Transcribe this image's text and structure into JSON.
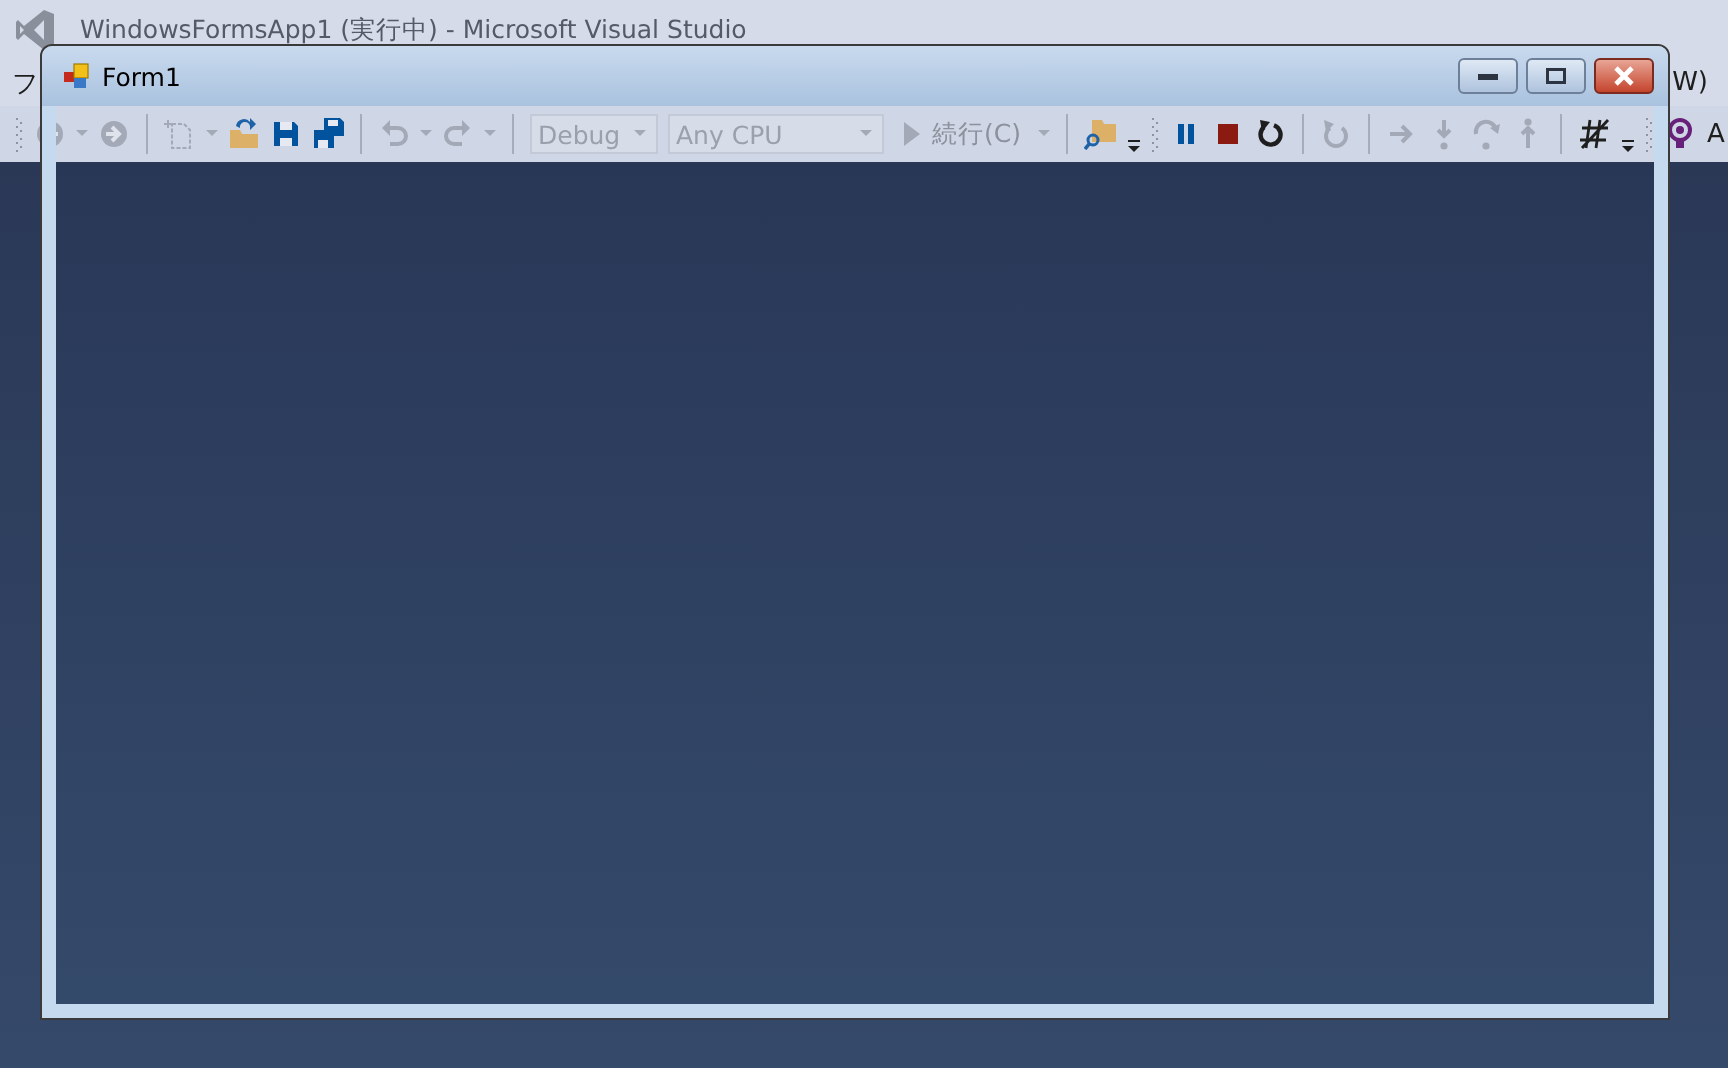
{
  "ide": {
    "title": "WindowsFormsApp1 (実行中) - Microsoft Visual Studio",
    "menu": [
      {
        "label": "フ"
      },
      {
        "label": "W)"
      }
    ],
    "toolbar": [
      {
        "kind": "back",
        "disabled": true
      },
      {
        "kind": "caret",
        "disabled": true
      },
      {
        "kind": "forward",
        "disabled": true
      },
      {
        "kind": "separator"
      },
      {
        "kind": "new-item",
        "disabled": true
      },
      {
        "kind": "caret",
        "disabled": true
      },
      {
        "kind": "open",
        "disabled": false
      },
      {
        "kind": "save",
        "disabled": false
      },
      {
        "kind": "save-all",
        "disabled": false
      },
      {
        "kind": "separator"
      },
      {
        "kind": "undo",
        "disabled": true
      },
      {
        "kind": "caret",
        "disabled": true
      },
      {
        "kind": "redo",
        "disabled": true
      },
      {
        "kind": "caret",
        "disabled": true
      },
      {
        "kind": "separator"
      },
      {
        "kind": "combo",
        "text": "Debug",
        "disabled": true,
        "wide": false
      },
      {
        "kind": "combo",
        "text": "Any CPU",
        "disabled": true,
        "wide": true
      },
      {
        "kind": "run",
        "text": "続行(C)",
        "disabled": true
      },
      {
        "kind": "caret",
        "disabled": true
      },
      {
        "kind": "separator"
      },
      {
        "kind": "find",
        "disabled": false
      },
      {
        "kind": "overflow"
      },
      {
        "kind": "grip"
      },
      {
        "kind": "pause",
        "disabled": false
      },
      {
        "kind": "stop",
        "disabled": false
      },
      {
        "kind": "restart",
        "disabled": false
      },
      {
        "kind": "separator"
      },
      {
        "kind": "refresh",
        "disabled": true
      },
      {
        "kind": "separator"
      },
      {
        "kind": "step-right",
        "disabled": true
      },
      {
        "kind": "step-down",
        "disabled": true
      },
      {
        "kind": "step-over",
        "disabled": true
      },
      {
        "kind": "step-up",
        "disabled": true
      },
      {
        "kind": "separator"
      },
      {
        "kind": "hash",
        "disabled": false
      },
      {
        "kind": "overflow"
      },
      {
        "kind": "grip"
      },
      {
        "kind": "bulb",
        "disabled": false
      },
      {
        "kind": "label",
        "text": "A"
      }
    ]
  },
  "form": {
    "title": "Form1"
  }
}
